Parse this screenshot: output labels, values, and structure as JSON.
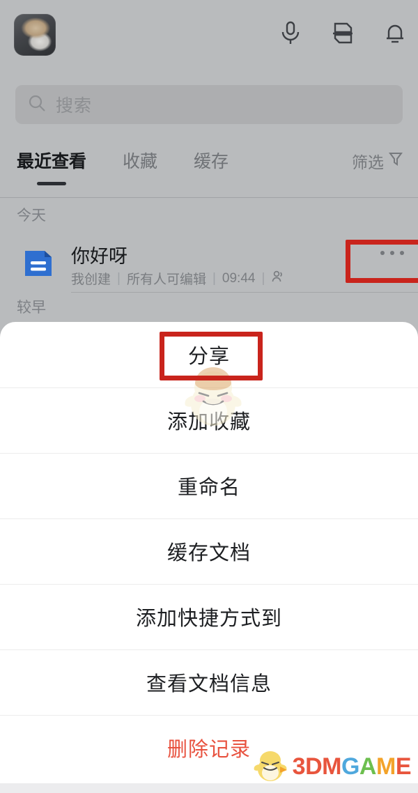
{
  "topbar": {
    "avatar_alt": "用户头像",
    "icons": [
      {
        "name": "microphone-icon",
        "label": "语音"
      },
      {
        "name": "scan-document-icon",
        "label": "扫描"
      },
      {
        "name": "bell-icon",
        "label": "通知"
      }
    ]
  },
  "search": {
    "placeholder": "搜索",
    "icon": "search-icon"
  },
  "tabs": {
    "items": [
      {
        "label": "最近查看",
        "active": true
      },
      {
        "label": "收藏",
        "active": false
      },
      {
        "label": "缓存",
        "active": false
      }
    ],
    "filter_label": "筛选",
    "filter_icon": "filter-funnel-icon"
  },
  "sections": {
    "today": "今天",
    "earlier": "较早"
  },
  "document": {
    "title": "你好呀",
    "icon": "document-blue-icon",
    "meta": {
      "owner": "我创建",
      "permission": "所有人可编辑",
      "time": "09:44",
      "people_icon": "people-icon",
      "separator": "|"
    },
    "more_button": "more-dots-button"
  },
  "action_sheet": {
    "items": [
      {
        "label": "分享",
        "danger": false,
        "highlighted": true
      },
      {
        "label": "添加收藏",
        "danger": false,
        "highlighted": false
      },
      {
        "label": "重命名",
        "danger": false,
        "highlighted": false
      },
      {
        "label": "缓存文档",
        "danger": false,
        "highlighted": false
      },
      {
        "label": "添加快捷方式到",
        "danger": false,
        "highlighted": false
      },
      {
        "label": "查看文档信息",
        "danger": false,
        "highlighted": false
      },
      {
        "label": "删除记录",
        "danger": true,
        "highlighted": false
      }
    ]
  },
  "watermark": {
    "brand_3dm": "3DM",
    "brand_g": "G",
    "brand_a": "A",
    "brand_m": "M",
    "brand_e": "E",
    "mascot": "chick-mascot-icon"
  },
  "colors": {
    "highlight_red": "#c9241c",
    "danger_text": "#e8523f",
    "doc_icon_blue": "#2f6fd0",
    "dim_background": "#b9bbbd",
    "sheet_white": "#ffffff"
  }
}
